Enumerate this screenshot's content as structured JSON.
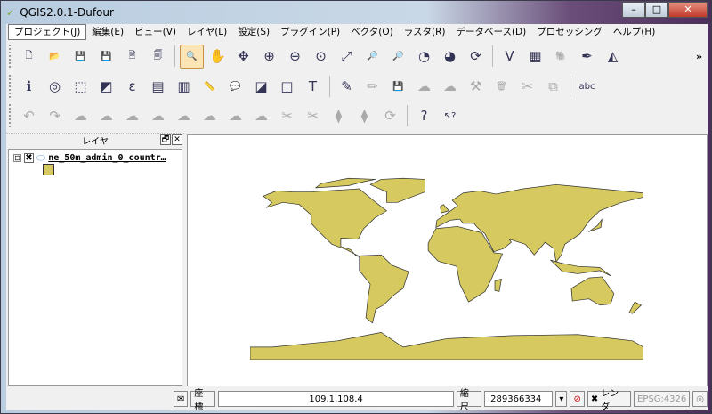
{
  "window": {
    "title": "QGIS2.0.1-Dufour",
    "minimize": "–",
    "maximize": "□",
    "close": "✕"
  },
  "menu": [
    "プロジェクト(J)",
    "編集(E)",
    "ビュー(V)",
    "レイヤ(L)",
    "設定(S)",
    "プラグイン(P)",
    "ベクタ(O)",
    "ラスタ(R)",
    "データベース(D)",
    "プロセッシング",
    "ヘルプ(H)"
  ],
  "toolbar1": [
    {
      "name": "new-project",
      "g": "🗋"
    },
    {
      "name": "open-project",
      "g": "📂"
    },
    {
      "name": "save-project",
      "g": "💾"
    },
    {
      "name": "save-as",
      "g": "💾"
    },
    {
      "name": "new-print-composer",
      "g": "🗎"
    },
    {
      "name": "composer-manager",
      "g": "🗐"
    },
    {
      "name": "pan-to-selection",
      "g": "🔍"
    },
    {
      "name": "pan",
      "g": "✋"
    },
    {
      "name": "pan-map-to-selection",
      "g": "✥"
    },
    {
      "name": "zoom-in",
      "g": "⊕"
    },
    {
      "name": "zoom-out",
      "g": "⊖"
    },
    {
      "name": "zoom-actual",
      "g": "⊙"
    },
    {
      "name": "zoom-full",
      "g": "⤢"
    },
    {
      "name": "zoom-selection",
      "g": "🔎"
    },
    {
      "name": "zoom-layer",
      "g": "🔎"
    },
    {
      "name": "zoom-last",
      "g": "◔"
    },
    {
      "name": "zoom-next",
      "g": "◕"
    },
    {
      "name": "refresh",
      "g": "⟳"
    },
    {
      "name": "add-vector-layer",
      "g": "V"
    },
    {
      "name": "add-raster-layer",
      "g": "▦"
    },
    {
      "name": "add-postgis-layer",
      "g": "🐘"
    },
    {
      "name": "add-spatialite-layer",
      "g": "✒"
    },
    {
      "name": "add-wms-layer",
      "g": "◭"
    }
  ],
  "toolbar2": [
    {
      "name": "identify",
      "g": "ℹ"
    },
    {
      "name": "identify-dropdown",
      "g": "◎"
    },
    {
      "name": "select",
      "g": "⬚"
    },
    {
      "name": "deselect",
      "g": "◩"
    },
    {
      "name": "expression-select",
      "g": "ε"
    },
    {
      "name": "attribute-table",
      "g": "▤"
    },
    {
      "name": "field-calculator",
      "g": "▥"
    },
    {
      "name": "measure",
      "g": "📏"
    },
    {
      "name": "annotation",
      "g": "💬"
    },
    {
      "name": "map-tips",
      "g": "◪"
    },
    {
      "name": "new-bookmark",
      "g": "◫"
    },
    {
      "name": "text-annotation",
      "g": "T"
    },
    {
      "name": "toggle-editing",
      "g": "✎"
    },
    {
      "name": "current-edits",
      "g": "✏"
    },
    {
      "name": "save-edits",
      "g": "💾"
    },
    {
      "name": "add-feature",
      "g": "☁"
    },
    {
      "name": "move-feature",
      "g": "☁"
    },
    {
      "name": "node-tool",
      "g": "⚒"
    },
    {
      "name": "delete-selected",
      "g": "🗑"
    },
    {
      "name": "cut-features",
      "g": "✂"
    },
    {
      "name": "copy-features",
      "g": "⧉"
    },
    {
      "name": "label",
      "g": "abc"
    }
  ],
  "toolbar3": [
    {
      "name": "undo",
      "g": "↶"
    },
    {
      "name": "redo",
      "g": "↷"
    },
    {
      "name": "simplify",
      "g": "☁"
    },
    {
      "name": "add-ring",
      "g": "☁"
    },
    {
      "name": "add-part",
      "g": "☁"
    },
    {
      "name": "fill-ring",
      "g": "☁"
    },
    {
      "name": "delete-ring",
      "g": "☁"
    },
    {
      "name": "delete-part",
      "g": "☁"
    },
    {
      "name": "reshape",
      "g": "☁"
    },
    {
      "name": "offset-curve",
      "g": "☁"
    },
    {
      "name": "split-features",
      "g": "✂"
    },
    {
      "name": "split-parts",
      "g": "✂"
    },
    {
      "name": "merge-selected",
      "g": "⧫"
    },
    {
      "name": "merge-attributes",
      "g": "⧫"
    },
    {
      "name": "rotate-symbols",
      "g": "⟳"
    },
    {
      "name": "help-contents",
      "g": "?"
    },
    {
      "name": "whats-this",
      "g": "↖?"
    }
  ],
  "layers_panel": {
    "title": "レイヤ",
    "float": "🗗",
    "close": "✕",
    "layer_name": "ne_50m_admin_0_countr…",
    "expand": "⊟",
    "visible": "✖"
  },
  "map": {
    "fill": "#d5c95f",
    "stroke": "#333333"
  },
  "status": {
    "coord_label": "座標",
    "coord_value": "109.1,108.4",
    "scale_label": "縮尺",
    "scale_value": ":289366334",
    "render_label": "レンダ",
    "render_checked": "✖",
    "crs": "EPSG:4326",
    "dropdown": "▾"
  }
}
